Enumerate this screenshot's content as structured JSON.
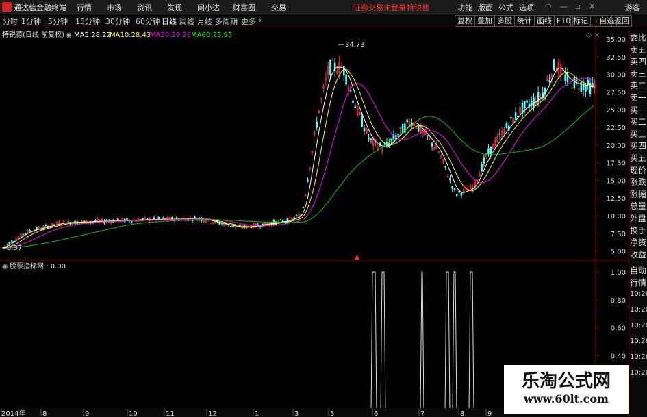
{
  "app": {
    "title": "通达信金融终端",
    "menu": [
      "行情",
      "市场",
      "资讯",
      "发现",
      "问小达",
      "财富圈",
      "交易"
    ],
    "login_notice": "证券交易未登录",
    "stock_name_top": "特锐德",
    "right_menu": [
      "功能",
      "版面",
      "公式",
      "选项"
    ],
    "user": "游客"
  },
  "toolbar": {
    "periods": [
      "分时",
      "1分钟",
      "5分钟",
      "15分钟",
      "30分钟",
      "60分钟",
      "日线",
      "周线",
      "月线",
      "多周期",
      "更多"
    ],
    "active_period": "日线",
    "right_buttons": [
      "复权",
      "叠加",
      "多股",
      "统计",
      "画线",
      "F10",
      "标记",
      "+自选",
      "返回"
    ]
  },
  "main_chart": {
    "title": "特锐德(日线 前复权)",
    "ma": [
      {
        "label": "MA5:",
        "value": "28.22",
        "color": "#ffffff"
      },
      {
        "label": "MA10:",
        "value": "28.43",
        "color": "#ffff00"
      },
      {
        "label": "MA20:",
        "value": "29.26",
        "color": "#ff00ff"
      },
      {
        "label": "MA60:",
        "value": "25.95",
        "color": "#00ff00"
      }
    ],
    "high_label": "34.73",
    "low_label": "5.37",
    "yticks": [
      "35.00",
      "32.50",
      "30.00",
      "27.50",
      "25.00",
      "22.50",
      "20.00",
      "17.50",
      "15.00",
      "12.50",
      "10.00",
      "7.50",
      "5.00"
    ]
  },
  "indicator": {
    "title": "股票指标网 : 0.00",
    "yticks": [
      "1.00",
      "0.80",
      "0.60",
      "0.40"
    ]
  },
  "xaxis": {
    "labels": [
      "2014年",
      "8",
      "9",
      "10",
      "11",
      "12",
      "1",
      "3",
      "5",
      "6",
      "7",
      "8",
      "9"
    ]
  },
  "sidebar": {
    "quote_labels": [
      "委比",
      "卖五",
      "卖四",
      "卖三",
      "卖二",
      "卖一",
      "买一",
      "买二",
      "买三",
      "买四",
      "买五",
      "现价",
      "涨跌",
      "涨幅",
      "总量",
      "外盘",
      "换手",
      "净资",
      "收益"
    ],
    "tabs": [
      "自动",
      "行情"
    ],
    "times": [
      "10:26",
      "10:26",
      "10:26",
      "10:26",
      "10:26",
      "10:26"
    ]
  },
  "watermark": {
    "line1": "乐淘公式网",
    "line2": "www.60lt.com"
  },
  "colors": {
    "up": "#ff3232",
    "down": "#54ffff",
    "ma5": "#ffffff",
    "ma10": "#ffff00",
    "ma20": "#ff00ff",
    "ma60": "#00c800",
    "axis": "#8b0000"
  }
}
